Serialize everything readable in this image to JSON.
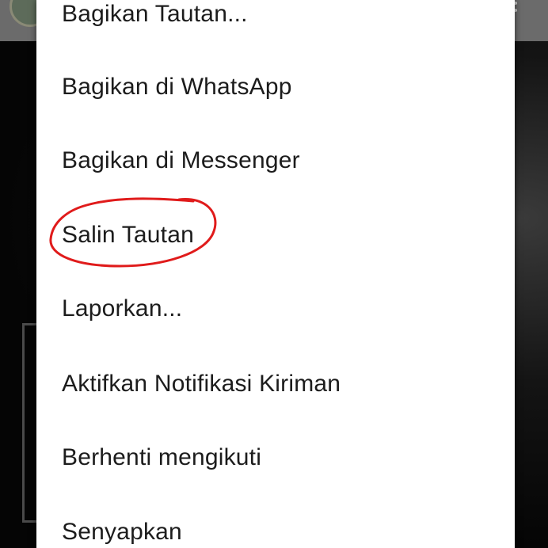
{
  "menu": {
    "items": [
      {
        "label": "Bagikan Tautan..."
      },
      {
        "label": "Bagikan di WhatsApp"
      },
      {
        "label": "Bagikan di Messenger"
      },
      {
        "label": "Salin Tautan"
      },
      {
        "label": "Laporkan..."
      },
      {
        "label": "Aktifkan Notifikasi Kiriman"
      },
      {
        "label": "Berhenti mengikuti"
      },
      {
        "label": "Senyapkan"
      }
    ]
  },
  "annotation": {
    "color": "#e01b1b",
    "target": "Salin Tautan"
  },
  "colors": {
    "menu_background": "#ffffff",
    "menu_text": "#1c1c1c",
    "backdrop": "#050505"
  },
  "icons": {
    "overflow": "more-vertical-icon",
    "avatar": "profile-avatar-icon"
  }
}
